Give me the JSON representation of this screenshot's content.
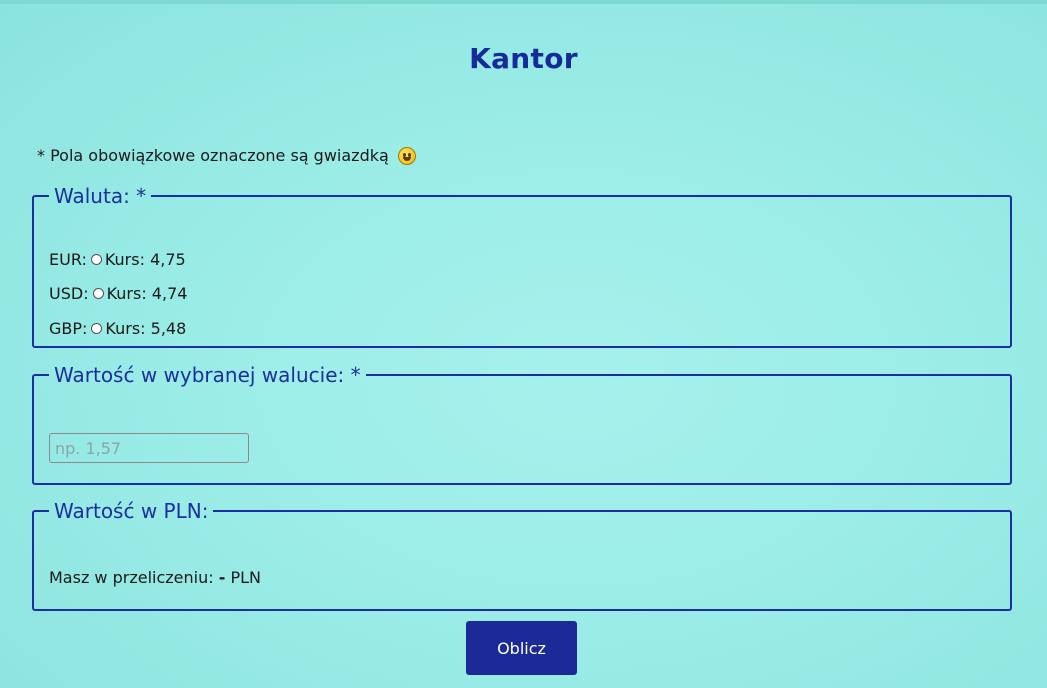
{
  "header": {
    "title": "Kantor"
  },
  "note": {
    "text": "* Pola obowiązkowe oznaczone są gwiazdką",
    "emoji_icon": "smiley-icon"
  },
  "currency_section": {
    "legend": "Waluta: *",
    "options": [
      {
        "code": "EUR:",
        "rate_label": "Kurs: 4,75",
        "checked": false
      },
      {
        "code": "USD:",
        "rate_label": "Kurs: 4,74",
        "checked": false
      },
      {
        "code": "GBP:",
        "rate_label": "Kurs: 5,48",
        "checked": false
      }
    ]
  },
  "value_section": {
    "legend": "Wartość w wybranej walucie: *",
    "input": {
      "value": "",
      "placeholder": "np. 1,57"
    }
  },
  "pln_section": {
    "legend": "Wartość w PLN:",
    "result_prefix": "Masz w przeliczeniu:",
    "result_value": "-",
    "result_unit": "PLN"
  },
  "actions": {
    "calculate_label": "Oblicz"
  },
  "colors": {
    "accent": "#1c2f9e",
    "button_bg": "#1c2a97",
    "background": "#9eeee9"
  }
}
